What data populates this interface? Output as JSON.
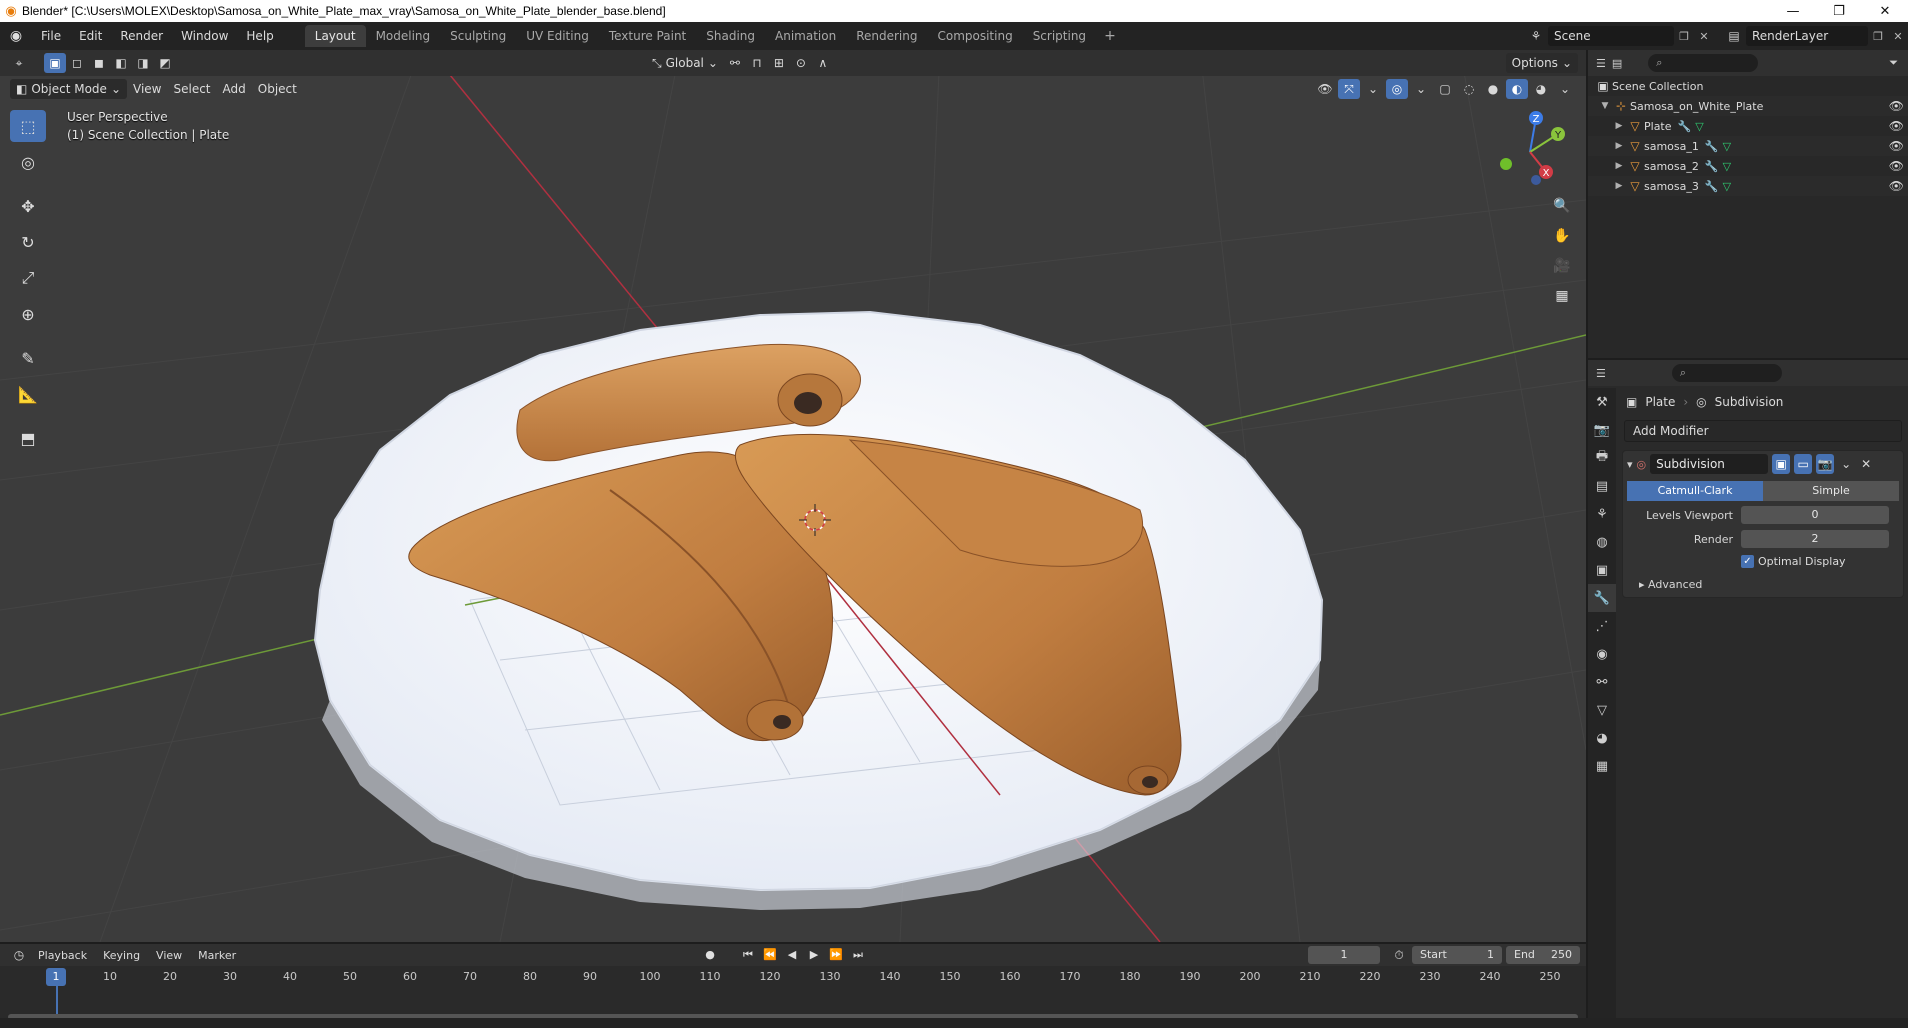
{
  "window": {
    "title": "Blender* [C:\\Users\\MOLEX\\Desktop\\Samosa_on_White_Plate_max_vray\\Samosa_on_White_Plate_blender_base.blend]",
    "minimize": "—",
    "maximize": "❐",
    "close": "✕"
  },
  "topbar": {
    "menus": [
      "File",
      "Edit",
      "Render",
      "Window",
      "Help"
    ],
    "workspaces": [
      "Layout",
      "Modeling",
      "Sculpting",
      "UV Editing",
      "Texture Paint",
      "Shading",
      "Animation",
      "Rendering",
      "Compositing",
      "Scripting"
    ],
    "active_workspace": "Layout",
    "add_workspace": "+",
    "scene": "Scene",
    "render_layer": "RenderLayer"
  },
  "viewport": {
    "mode": "Object Mode",
    "menus": [
      "View",
      "Select",
      "Add",
      "Object"
    ],
    "orientation": "Global",
    "options_label": "Options",
    "perspective_label": "User Perspective",
    "collection_label": "(1) Scene Collection | Plate",
    "gizmo_axes": {
      "x": "X",
      "y": "Y",
      "z": "Z"
    }
  },
  "outliner": {
    "root": "Scene Collection",
    "collection": "Samosa_on_White_Plate",
    "objects": [
      "Plate",
      "samosa_1",
      "samosa_2",
      "samosa_3"
    ]
  },
  "properties": {
    "object_name": "Plate",
    "modifier_crumb": "Subdivision",
    "add_modifier": "Add Modifier",
    "modifier": {
      "name": "Subdivision",
      "modes": [
        "Catmull-Clark",
        "Simple"
      ],
      "active_mode": "Catmull-Clark",
      "levels_viewport_label": "Levels Viewport",
      "levels_viewport": "0",
      "render_label": "Render",
      "render": "2",
      "optimal_display_label": "Optimal Display",
      "optimal_display": true,
      "advanced_label": "Advanced"
    }
  },
  "timeline": {
    "menus": [
      "Playback",
      "Keying",
      "View",
      "Marker"
    ],
    "current_frame": "1",
    "start_label": "Start",
    "start": "1",
    "end_label": "End",
    "end": "250",
    "ticks": [
      "10",
      "20",
      "30",
      "40",
      "50",
      "60",
      "70",
      "80",
      "90",
      "100",
      "110",
      "120",
      "130",
      "140",
      "150",
      "160",
      "170",
      "180",
      "190",
      "200",
      "210",
      "220",
      "230",
      "240",
      "250"
    ]
  },
  "colors": {
    "accent": "#4772b3",
    "viewport_bg": "#3c3c3c",
    "plate": "#f4f6fb",
    "samosa": "#c98a4a",
    "x_axis": "#d23c46",
    "y_axis": "#8ac43c",
    "z_axis": "#3c7ce8"
  }
}
